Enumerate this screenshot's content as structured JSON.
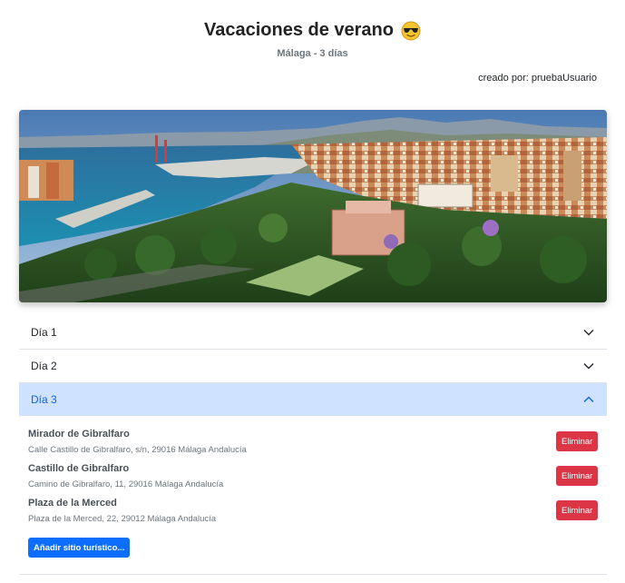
{
  "header": {
    "title": "Vacaciones de verano",
    "subtitle": "Málaga - 3 días",
    "creator": "creado por: pruebaUsuario"
  },
  "days": [
    {
      "label": "Día 1",
      "open": false
    },
    {
      "label": "Día 2",
      "open": false
    },
    {
      "label": "Día 3",
      "open": true
    }
  ],
  "day3_places": [
    {
      "name": "Mirador de Gibralfaro",
      "address": "Calle Castillo de Gibralfaro, s/n, 29016 Málaga Andalucía",
      "delete_label": "Eliminar"
    },
    {
      "name": "Castillo de Gibralfaro",
      "address": "Camino de Gibralfaro, 11, 29016 Málaga Andalucía",
      "delete_label": "Eliminar"
    },
    {
      "name": "Plaza de la Merced",
      "address": "Plaza de la Merced, 22, 29012 Málaga Andalucía",
      "delete_label": "Eliminar"
    }
  ],
  "add_button_label": "Añadir sitio turístico...",
  "icons": {
    "title_emoji": "sunglasses-emoji-icon",
    "chevron_closed": "chevron-down-icon",
    "chevron_open": "chevron-up-icon"
  },
  "colors": {
    "accent": "#0d6efd",
    "danger": "#dc3545",
    "open_header_bg": "#cfe2ff"
  }
}
